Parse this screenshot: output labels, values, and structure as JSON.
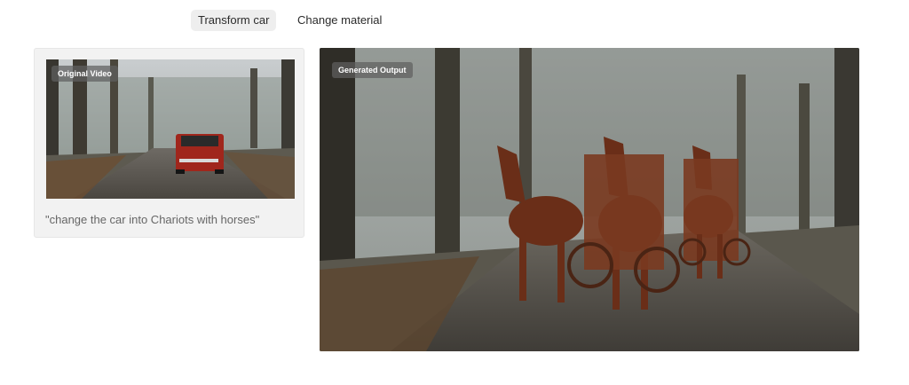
{
  "tabs": [
    {
      "label": "Transform car",
      "active": true
    },
    {
      "label": "Change material",
      "active": false
    }
  ],
  "input_card": {
    "badge": "Original Video",
    "prompt": "\"change the car into Chariots with horses\""
  },
  "output": {
    "badge": "Generated Output"
  },
  "colors": {
    "active_tab_bg": "#eeeeee",
    "card_bg": "#f2f2f2",
    "badge_bg": "#5f5f5f",
    "car_red": "#a0261c",
    "horse_brown": "#6a2e18"
  }
}
